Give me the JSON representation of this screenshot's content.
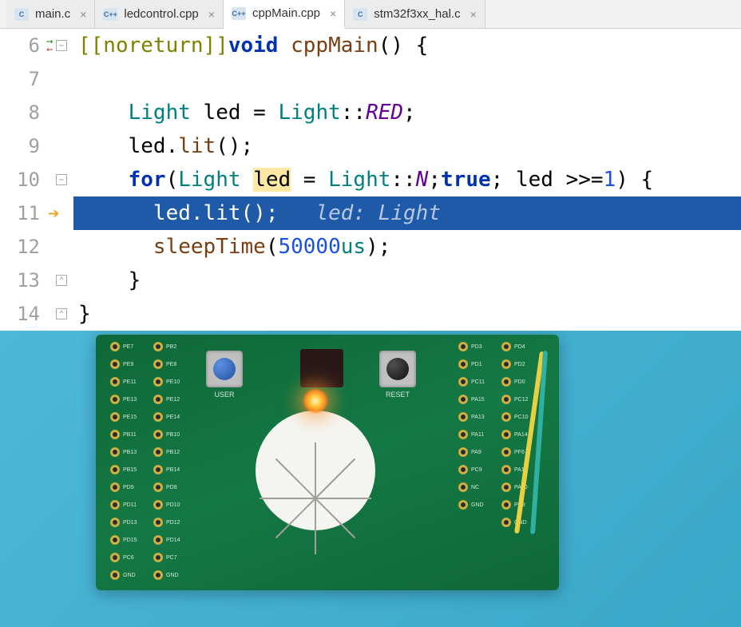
{
  "tabs": [
    {
      "icon": "C",
      "label": "main.c",
      "close": "×",
      "active": false
    },
    {
      "icon": "C++",
      "label": "ledcontrol.cpp",
      "close": "×",
      "active": false
    },
    {
      "icon": "C++",
      "label": "cppMain.cpp",
      "close": "×",
      "active": true
    },
    {
      "icon": "C",
      "label": "stm32f3xx_hal.c",
      "close": "×",
      "active": false
    }
  ],
  "lines": {
    "nums": [
      "6",
      "7",
      "8",
      "9",
      "10",
      "11",
      "12",
      "13",
      "14"
    ],
    "l6": {
      "attr": "[[noreturn]]",
      "kw": "void",
      "fn": "cppMain",
      "rest": "() {"
    },
    "l8": {
      "type1": "Light",
      "ident": " led = ",
      "type2": "Light",
      "sep": "::",
      "enum": "RED",
      "end": ";"
    },
    "l9": {
      "call": "led.",
      "fn": "lit",
      "rest": "();"
    },
    "l10": {
      "kw1": "for",
      "p1": "(",
      "type1": "Light",
      "sp1": " ",
      "var": "led",
      "eq": " = ",
      "type2": "Light",
      "sep": "::",
      "enum": "N",
      "semi1": ";",
      "kw2": "true",
      "semi2": "; led >>=",
      "num": "1",
      "rest": ") {"
    },
    "l11": {
      "call": "led.",
      "fn": "lit",
      "rest": "();",
      "hint": "led: Light"
    },
    "l12": {
      "fn": "sleepTime",
      "p1": "(",
      "num": "50000",
      "unit": "us",
      "rest": ");"
    },
    "l13": {
      "brace": "}"
    },
    "l14": {
      "brace": "}"
    }
  },
  "board": {
    "user_label": "USER",
    "reset_label": "RESET",
    "pins_left": [
      "PE7",
      "PE9",
      "PE11",
      "PE13",
      "PE15",
      "PB11",
      "PB13",
      "PB15",
      "PD9",
      "PD11",
      "PD13",
      "PD15",
      "PC6",
      "GND"
    ],
    "pins_left2": [
      "PB2",
      "PE8",
      "PE10",
      "PE12",
      "PE14",
      "PB10",
      "PB12",
      "PB14",
      "PD8",
      "PD10",
      "PD12",
      "PD14",
      "PC7",
      "GND"
    ],
    "pins_right": [
      "PD4",
      "PD2",
      "PD0",
      "PC12",
      "PC10",
      "PA14",
      "PF6",
      "PA12",
      "PA10",
      "PC8",
      "GND"
    ],
    "pins_right2": [
      "PD3",
      "PD1",
      "PC11",
      "PA15",
      "PA13",
      "PA11",
      "PA9",
      "PC9",
      "NC",
      "GND"
    ]
  }
}
